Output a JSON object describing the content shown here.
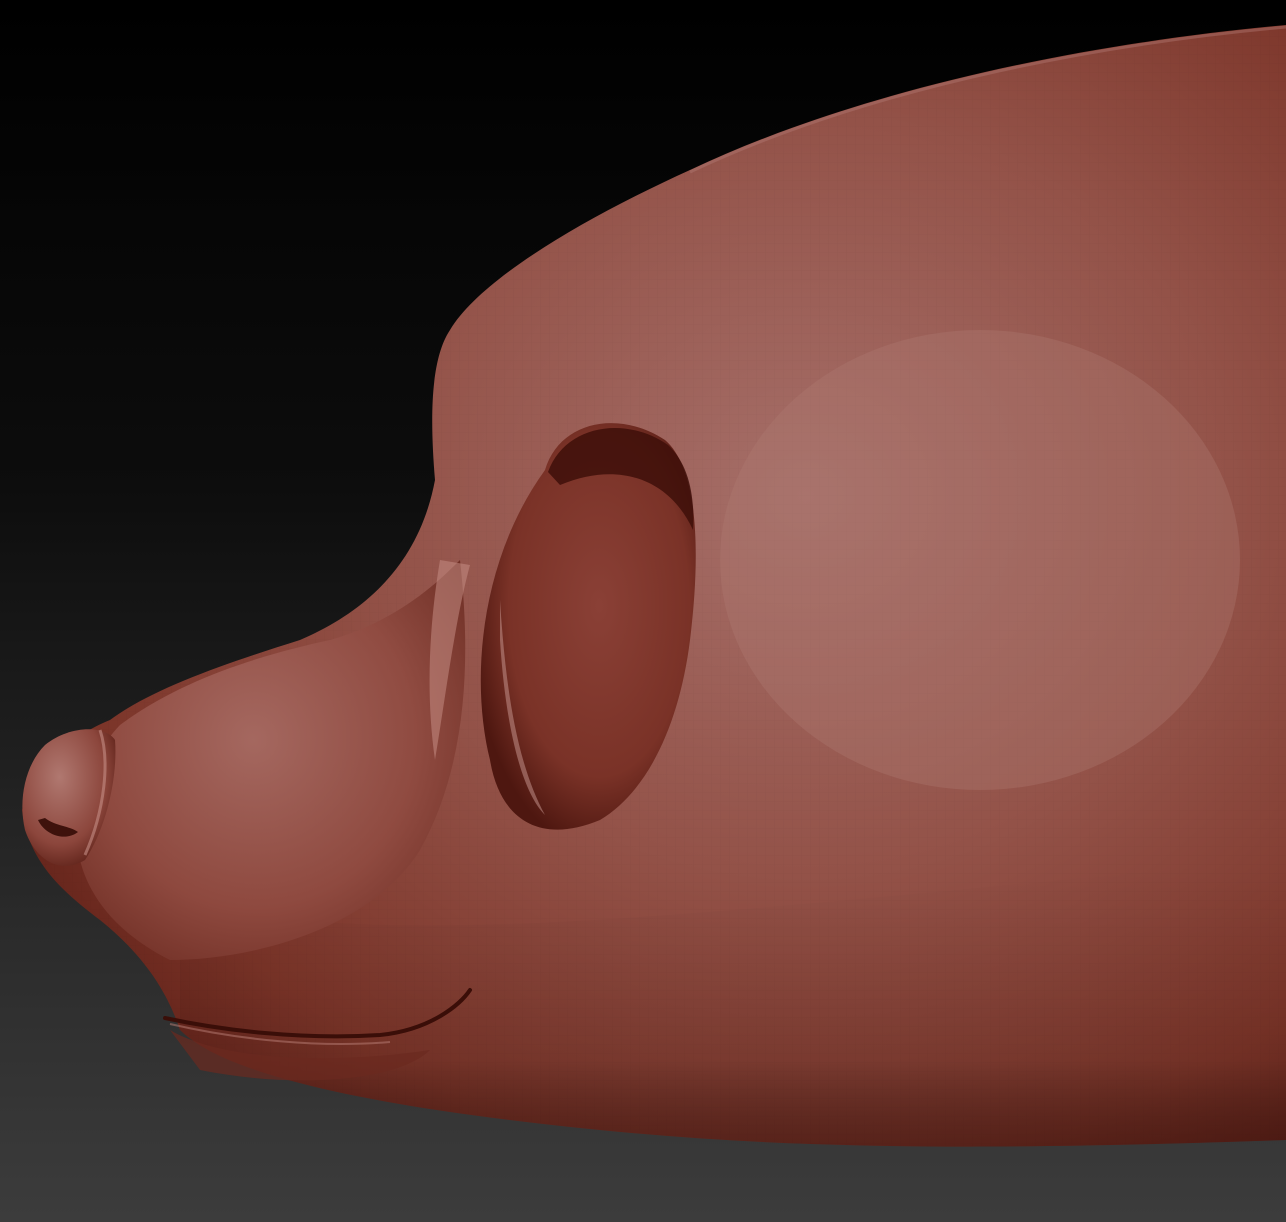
{
  "scene": {
    "subject": "sculpted-head-side-view",
    "colors": {
      "background_top": "#000000",
      "background_bottom": "#3c3c3c",
      "clay_highlight": "#a8706a",
      "clay_mid": "#8f4a40",
      "clay_shadow": "#5a1f18"
    }
  }
}
